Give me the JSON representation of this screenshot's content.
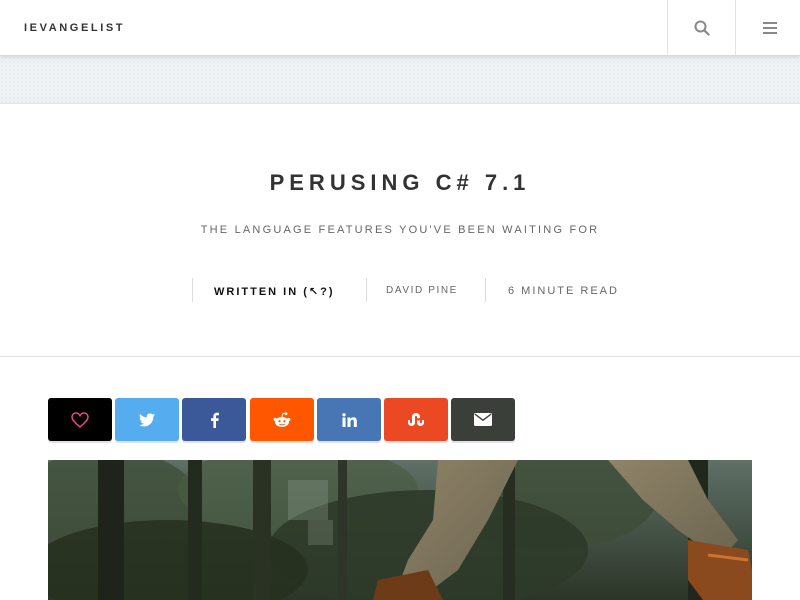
{
  "site": {
    "brand": "IEVANGELIST",
    "nav_icons": [
      "search-icon",
      "menu-icon"
    ]
  },
  "post": {
    "title": "PERUSING C# 7.1",
    "subtitle": "THE LANGUAGE FEATURES YOU'VE BEEN WAITING FOR",
    "meta": {
      "written_in": "WRITTEN IN (↖?)",
      "author": "DAVID PINE",
      "read_time": "6 MINUTE READ"
    }
  },
  "share": [
    {
      "name": "like",
      "icon": "heart-icon",
      "color": "#000000",
      "icon_color": "#e8457a"
    },
    {
      "name": "twitter",
      "icon": "twitter-icon",
      "color": "#55acee",
      "icon_color": "#ffffff"
    },
    {
      "name": "facebook",
      "icon": "facebook-icon",
      "color": "#3b5998",
      "icon_color": "#ffffff"
    },
    {
      "name": "reddit",
      "icon": "reddit-icon",
      "color": "#ff5700",
      "icon_color": "#ffffff"
    },
    {
      "name": "linkedin",
      "icon": "linkedin-icon",
      "color": "#4875b4",
      "icon_color": "#ffffff"
    },
    {
      "name": "stumbleupon",
      "icon": "stumbleupon-icon",
      "color": "#eb4924",
      "icon_color": "#ffffff"
    },
    {
      "name": "email",
      "icon": "email-icon",
      "color": "#3b3f3a",
      "icon_color": "#ffffff"
    }
  ],
  "hero": {
    "icon": "forest-hiker-photo"
  }
}
